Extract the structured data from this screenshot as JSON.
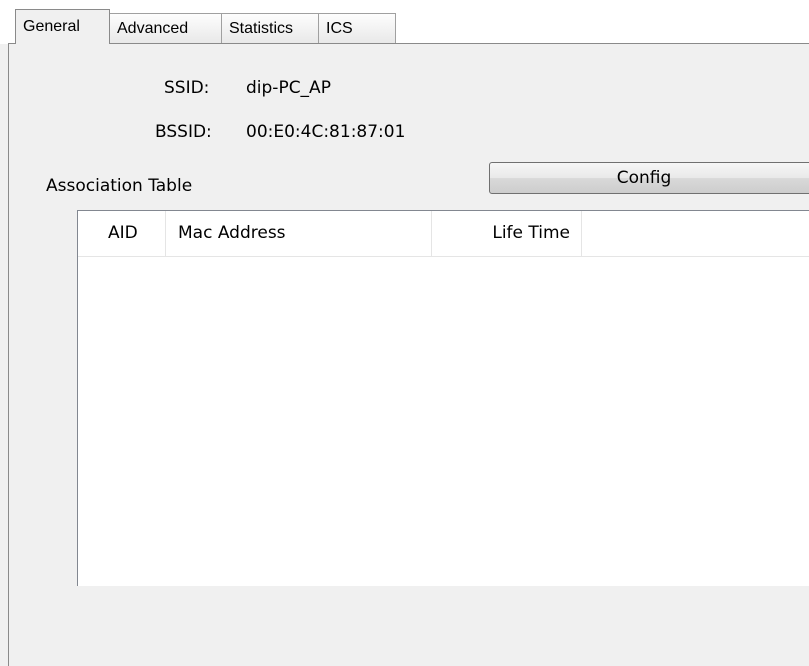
{
  "tabs": [
    {
      "label": "General",
      "active": true
    },
    {
      "label": "Advanced",
      "active": false
    },
    {
      "label": "Statistics",
      "active": false
    },
    {
      "label": "ICS",
      "active": false
    }
  ],
  "info": {
    "ssid_label": "SSID:",
    "ssid_value": "dip-PC_AP",
    "bssid_label": "BSSID:",
    "bssid_value": "00:E0:4C:81:87:01"
  },
  "association": {
    "section_label": "Association Table",
    "config_button_label": "Config",
    "columns": [
      "AID",
      "Mac Address",
      "Life Time"
    ],
    "rows": []
  }
}
